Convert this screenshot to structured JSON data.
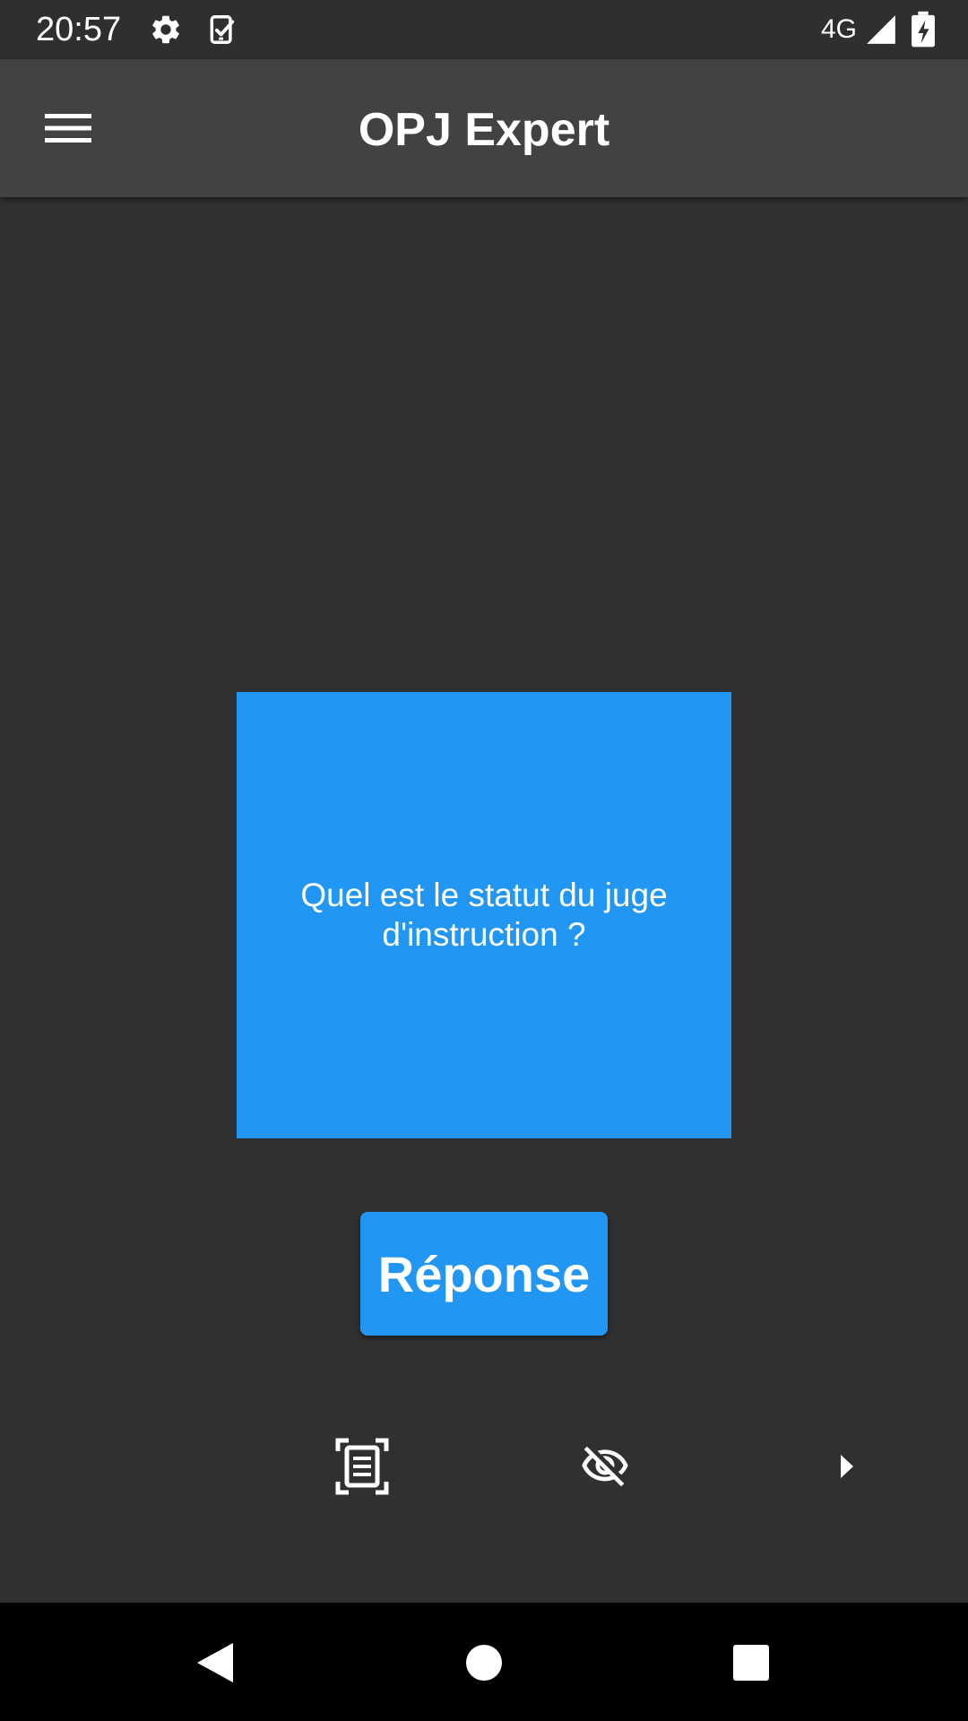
{
  "status_bar": {
    "time": "20:57",
    "network": "4G",
    "icons": [
      "settings-icon",
      "task-check-icon",
      "signal-icon",
      "battery-charging-icon"
    ]
  },
  "app_bar": {
    "title": "OPJ Expert",
    "menu_icon": "hamburger-menu-icon"
  },
  "card": {
    "question": "Quel est le statut du juge d'instruction ?"
  },
  "answer_button": {
    "label": "Réponse"
  },
  "actions": {
    "icons": [
      "document-scan-icon",
      "eye-off-icon",
      "play-arrow-icon"
    ]
  },
  "nav_bar": {
    "icons": [
      "back-icon",
      "home-icon",
      "recents-icon"
    ]
  },
  "colors": {
    "background": "#303030",
    "app_bar": "#424242",
    "accent": "#2196f3",
    "nav_bar": "#000000"
  }
}
